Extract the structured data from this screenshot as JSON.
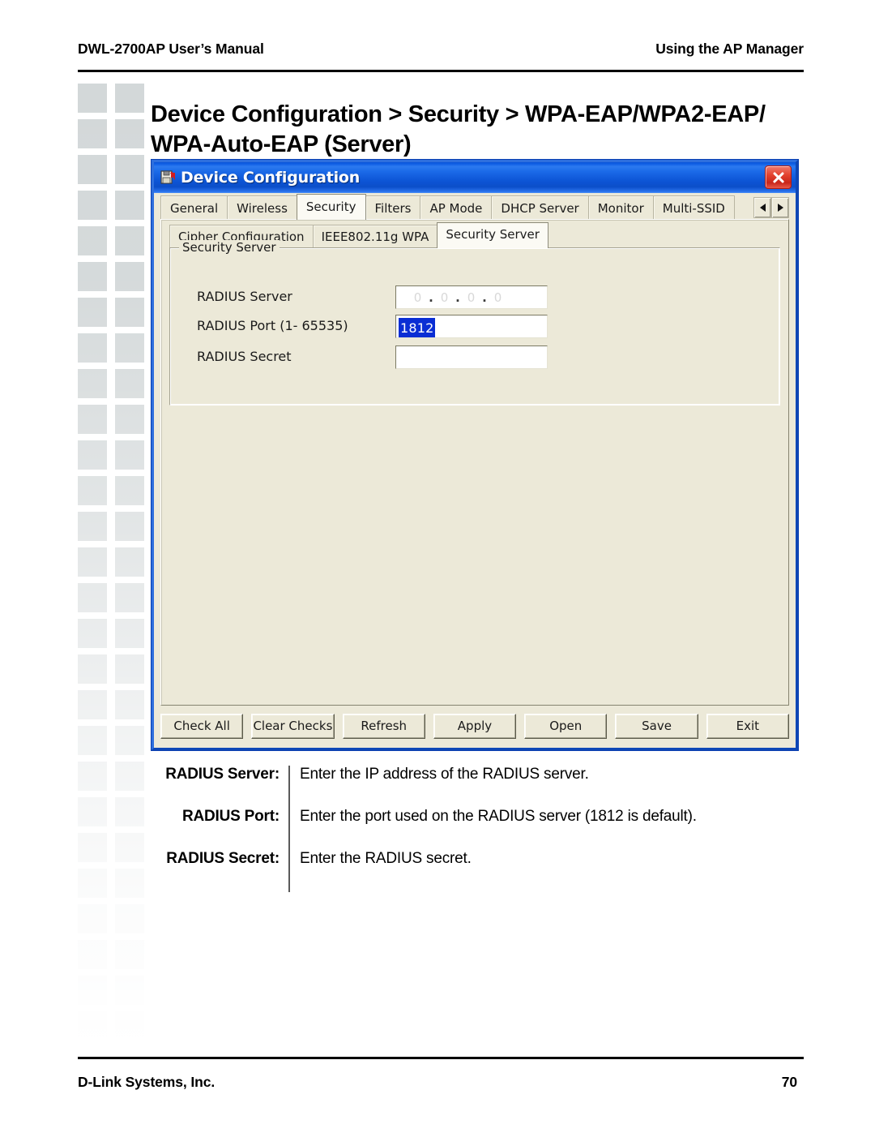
{
  "page": {
    "header_left": "DWL-2700AP User’s Manual",
    "header_right": "Using the AP Manager",
    "title": "Device Configuration > Security > WPA-EAP/WPA2-EAP/ WPA-Auto-EAP (Server)",
    "footer_left": "D-Link Systems, Inc.",
    "footer_page_number": "70"
  },
  "dialog": {
    "title": "Device Configuration",
    "icon": "device-config-icon",
    "close_icon": "close-icon",
    "tabs": [
      {
        "label": "General",
        "selected": false
      },
      {
        "label": "Wireless",
        "selected": false
      },
      {
        "label": "Security",
        "selected": true
      },
      {
        "label": "Filters",
        "selected": false
      },
      {
        "label": "AP Mode",
        "selected": false
      },
      {
        "label": "DHCP Server",
        "selected": false
      },
      {
        "label": "Monitor",
        "selected": false
      },
      {
        "label": "Multi-SSID",
        "selected": false
      }
    ],
    "tab_scroll": {
      "prev_icon": "triangle-left-icon",
      "next_icon": "triangle-right-icon"
    },
    "subtabs": [
      {
        "label": "Cipher Configuration",
        "selected": false
      },
      {
        "label": "IEEE802.11g WPA",
        "selected": false
      },
      {
        "label": "Security Server",
        "selected": true
      }
    ],
    "groupbox": {
      "legend": "Security Server",
      "fields": [
        {
          "label": "RADIUS Server",
          "type": "ip",
          "value": "",
          "ip_segments": [
            "0",
            "0",
            "0",
            "0"
          ],
          "separator": "."
        },
        {
          "label": "RADIUS Port  (1- 65535)",
          "type": "text",
          "value": "1812",
          "selected": true
        },
        {
          "label": "RADIUS Secret",
          "type": "text",
          "value": ""
        }
      ]
    },
    "buttons": [
      "Check All",
      "Clear Checks",
      "Refresh",
      "Apply",
      "Open",
      "Save",
      "Exit"
    ]
  },
  "descriptions": [
    {
      "term": "RADIUS Server:",
      "definition": "Enter the IP address of the RADIUS server."
    },
    {
      "term": "RADIUS Port:",
      "definition": "Enter the port used on the RADIUS server (1812 is default)."
    },
    {
      "term": "RADIUS Secret:",
      "definition": "Enter the RADIUS secret."
    }
  ],
  "colors": {
    "dialog_titlebar_blue": "#0d55d6",
    "dialog_face": "#ece9d8",
    "selection_blue": "#0a2ed4",
    "close_red": "#c9261a",
    "deco_square_gray": "#d3d8d9"
  }
}
